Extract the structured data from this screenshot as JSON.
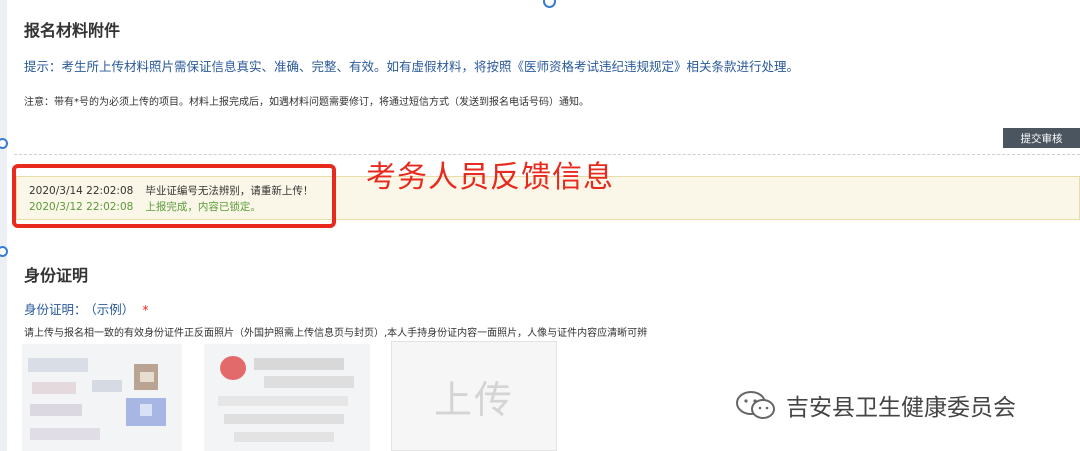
{
  "attachments": {
    "section_title": "报名材料附件",
    "hint": "提示：考生所上传材料照片需保证信息真实、准确、完整、有效。如有虚假材料，将按照《医师资格考试违纪违规规定》相关条款进行处理。",
    "note": "注意：带有*号的为必须上传的项目。材料上报完成后，如遇材料问题需要修订，将通过短信方式（发送到报名电话号码）通知。",
    "submit_label": "提交审核"
  },
  "feedback": {
    "entries": [
      {
        "time": "2020/3/14 22:02:08",
        "message": "毕业证编号无法辨别，请重新上传！"
      },
      {
        "time": "2020/3/12 22:02:08",
        "message": "上报完成，内容已锁定。"
      }
    ],
    "annotation": "考务人员反馈信息",
    "highlight_color": "#e8291d"
  },
  "id_section": {
    "title": "身份证明",
    "field_label": "身份证明：",
    "sample_link": "（示例）",
    "required_mark": "*",
    "description": "请上传与报名相一致的有效身份证件正反面照片（外国护照需上传信息页与封页）,本人手持身份证内容一面照片，人像与证件内容应清晰可辨",
    "upload_label": "上传"
  },
  "watermark": {
    "icon": "wechat-icon",
    "text": "吉安县卫生健康委员会"
  }
}
